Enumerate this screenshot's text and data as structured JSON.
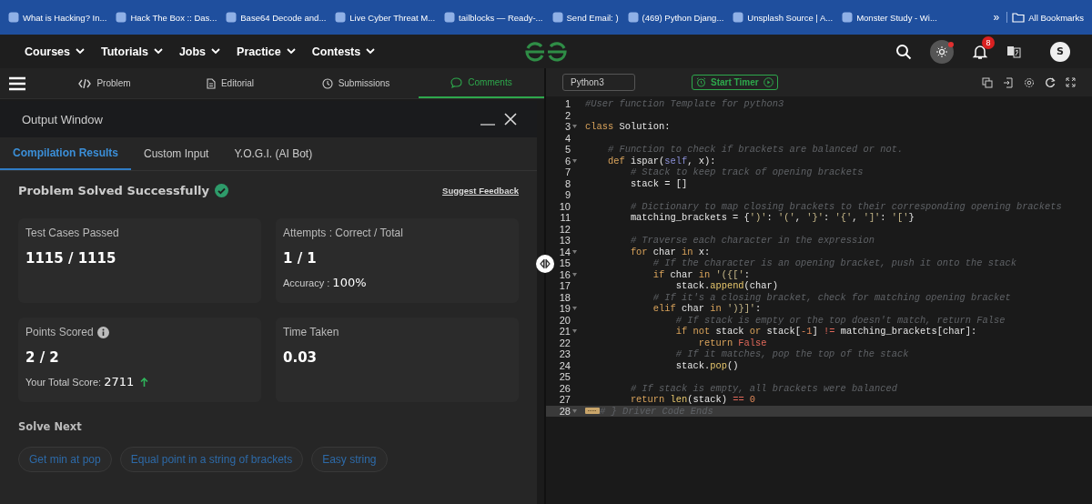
{
  "bookmarks": [
    {
      "title": "What is Hacking? In..."
    },
    {
      "title": "Hack The Box :: Das..."
    },
    {
      "title": "Base64 Decode and..."
    },
    {
      "title": "Live Cyber Threat M..."
    },
    {
      "title": "tailblocks — Ready-..."
    },
    {
      "title": "Send Email: )"
    },
    {
      "title": "(469) Python Djang..."
    },
    {
      "title": "Unsplash Source | A..."
    },
    {
      "title": "Monster Study - Wi..."
    }
  ],
  "bookmarks_more": "»",
  "all_bookmarks": "All Bookmarks",
  "nav": {
    "menus": [
      {
        "label": "Courses"
      },
      {
        "label": "Tutorials"
      },
      {
        "label": "Jobs"
      },
      {
        "label": "Practice"
      },
      {
        "label": "Contests"
      }
    ],
    "notifications": "8",
    "avatar": "S"
  },
  "problem_tabs": [
    {
      "label": "Problem",
      "selected": false
    },
    {
      "label": "Editorial",
      "selected": false
    },
    {
      "label": "Submissions",
      "selected": false
    },
    {
      "label": "Comments",
      "selected": true
    }
  ],
  "output_window": {
    "title": "Output Window",
    "tabs": [
      {
        "label": "Compilation Results",
        "selected": true
      },
      {
        "label": "Custom Input",
        "selected": false
      },
      {
        "label": "Y.O.G.I. (AI Bot)",
        "selected": false
      }
    ],
    "status": "Problem Solved Successfully",
    "feedback_link": "Suggest Feedback",
    "cards": [
      {
        "label": "Test Cases Passed",
        "info_icon": false,
        "value": "1115 / 1115"
      },
      {
        "label": "Attempts : Correct / Total",
        "info_icon": false,
        "value": "1 / 1",
        "sub": {
          "label": "Accuracy : ",
          "value": "100%",
          "rising": false
        }
      },
      {
        "label": "Points Scored",
        "info_icon": true,
        "value": "2 / 2",
        "sub": {
          "label": "Your Total Score: ",
          "value": "2711",
          "rising": true
        }
      },
      {
        "label": "Time Taken",
        "info_icon": false,
        "value": "0.03"
      }
    ],
    "solve_next": {
      "heading": "Solve Next",
      "items": [
        {
          "label": "Get min at pop"
        },
        {
          "label": "Equal point in a string of brackets"
        },
        {
          "label": "Easy string"
        }
      ]
    }
  },
  "editor": {
    "language": "Python3",
    "timer_button": "Start Timer",
    "lines": [
      {
        "n": "1",
        "fold": false,
        "active": false,
        "folded_marker": false,
        "tokens": [
          {
            "kind": "comment",
            "text": "#User function Template for python3"
          }
        ]
      },
      {
        "n": "2",
        "fold": false,
        "active": false,
        "folded_marker": false
      },
      {
        "n": "3",
        "fold": true,
        "active": false,
        "folded_marker": false,
        "tokens": [
          {
            "kind": "keyword",
            "text": "class"
          },
          {
            "kind": "plain",
            "text": " Solution:"
          }
        ]
      },
      {
        "n": "4",
        "fold": false,
        "active": false,
        "folded_marker": false
      },
      {
        "n": "5",
        "fold": false,
        "active": false,
        "folded_marker": false,
        "tokens": [
          {
            "kind": "comment",
            "text": "    # Function to check if brackets are balanced or not."
          }
        ]
      },
      {
        "n": "6",
        "fold": true,
        "active": false,
        "folded_marker": false,
        "tokens": [
          {
            "kind": "keyword",
            "text": "    def"
          },
          {
            "kind": "plain",
            "text": " ispar("
          },
          {
            "kind": "builtin",
            "text": "self"
          },
          {
            "kind": "plain",
            "text": ", x):"
          }
        ]
      },
      {
        "n": "7",
        "fold": false,
        "active": false,
        "folded_marker": false,
        "tokens": [
          {
            "kind": "comment",
            "text": "        # Stack to keep track of opening brackets"
          }
        ]
      },
      {
        "n": "8",
        "fold": false,
        "active": false,
        "folded_marker": false,
        "tokens": [
          {
            "kind": "plain",
            "text": "        stack = []"
          }
        ]
      },
      {
        "n": "9",
        "fold": false,
        "active": false,
        "folded_marker": false
      },
      {
        "n": "10",
        "fold": false,
        "active": false,
        "folded_marker": false,
        "tokens": [
          {
            "kind": "comment",
            "text": "        # Dictionary to map closing brackets to their corresponding opening brackets"
          }
        ]
      },
      {
        "n": "11",
        "fold": false,
        "active": false,
        "folded_marker": false,
        "tokens": [
          {
            "kind": "plain",
            "text": "        matching_brackets = {"
          },
          {
            "kind": "string",
            "text": "')'"
          },
          {
            "kind": "plain",
            "text": ": "
          },
          {
            "kind": "string",
            "text": "'('"
          },
          {
            "kind": "plain",
            "text": ", "
          },
          {
            "kind": "string",
            "text": "'}'"
          },
          {
            "kind": "plain",
            "text": ": "
          },
          {
            "kind": "string",
            "text": "'{'"
          },
          {
            "kind": "plain",
            "text": ", "
          },
          {
            "kind": "string",
            "text": "']'"
          },
          {
            "kind": "plain",
            "text": ": "
          },
          {
            "kind": "string",
            "text": "'['"
          },
          {
            "kind": "plain",
            "text": "}"
          }
        ]
      },
      {
        "n": "12",
        "fold": false,
        "active": false,
        "folded_marker": false
      },
      {
        "n": "13",
        "fold": false,
        "active": false,
        "folded_marker": false,
        "tokens": [
          {
            "kind": "comment",
            "text": "        # Traverse each character in the expression"
          }
        ]
      },
      {
        "n": "14",
        "fold": true,
        "active": false,
        "folded_marker": false,
        "tokens": [
          {
            "kind": "keyword",
            "text": "        for"
          },
          {
            "kind": "plain",
            "text": " char "
          },
          {
            "kind": "keyword",
            "text": "in"
          },
          {
            "kind": "plain",
            "text": " x:"
          }
        ]
      },
      {
        "n": "15",
        "fold": false,
        "active": false,
        "folded_marker": false,
        "tokens": [
          {
            "kind": "comment",
            "text": "            # If the character is an opening bracket, push it onto the stack"
          }
        ]
      },
      {
        "n": "16",
        "fold": true,
        "active": false,
        "folded_marker": false,
        "tokens": [
          {
            "kind": "keyword",
            "text": "            if"
          },
          {
            "kind": "plain",
            "text": " char "
          },
          {
            "kind": "keyword",
            "text": "in"
          },
          {
            "kind": "string",
            "text": " '({['"
          },
          {
            "kind": "plain",
            "text": ":"
          }
        ]
      },
      {
        "n": "17",
        "fold": false,
        "active": false,
        "folded_marker": false,
        "tokens": [
          {
            "kind": "plain",
            "text": "                stack."
          },
          {
            "kind": "call",
            "text": "append"
          },
          {
            "kind": "plain",
            "text": "(char)"
          }
        ]
      },
      {
        "n": "18",
        "fold": false,
        "active": false,
        "folded_marker": false,
        "tokens": [
          {
            "kind": "comment",
            "text": "            # If it's a closing bracket, check for matching opening bracket"
          }
        ]
      },
      {
        "n": "19",
        "fold": true,
        "active": false,
        "folded_marker": false,
        "tokens": [
          {
            "kind": "keyword",
            "text": "            elif"
          },
          {
            "kind": "plain",
            "text": " char "
          },
          {
            "kind": "keyword",
            "text": "in"
          },
          {
            "kind": "string",
            "text": " ')}]'"
          },
          {
            "kind": "plain",
            "text": ":"
          }
        ]
      },
      {
        "n": "20",
        "fold": false,
        "active": false,
        "folded_marker": false,
        "tokens": [
          {
            "kind": "comment",
            "text": "                # If stack is empty or the top doesn't match, return False"
          }
        ]
      },
      {
        "n": "21",
        "fold": true,
        "active": false,
        "folded_marker": false,
        "tokens": [
          {
            "kind": "keyword",
            "text": "                if not"
          },
          {
            "kind": "plain",
            "text": " stack "
          },
          {
            "kind": "keyword",
            "text": "or"
          },
          {
            "kind": "plain",
            "text": " stack["
          },
          {
            "kind": "number",
            "text": "-1"
          },
          {
            "kind": "plain",
            "text": "] "
          },
          {
            "kind": "operator",
            "text": "!="
          },
          {
            "kind": "plain",
            "text": " matching_brackets[char]:"
          }
        ]
      },
      {
        "n": "22",
        "fold": false,
        "active": false,
        "folded_marker": false,
        "tokens": [
          {
            "kind": "keyword",
            "text": "                    return"
          },
          {
            "kind": "constant",
            "text": " False"
          }
        ]
      },
      {
        "n": "23",
        "fold": false,
        "active": false,
        "folded_marker": false,
        "tokens": [
          {
            "kind": "comment",
            "text": "                # If it matches, pop the top of the stack"
          }
        ]
      },
      {
        "n": "24",
        "fold": false,
        "active": false,
        "folded_marker": false,
        "tokens": [
          {
            "kind": "plain",
            "text": "                stack."
          },
          {
            "kind": "call",
            "text": "pop"
          },
          {
            "kind": "plain",
            "text": "()"
          }
        ]
      },
      {
        "n": "25",
        "fold": false,
        "active": false,
        "folded_marker": false
      },
      {
        "n": "26",
        "fold": false,
        "active": false,
        "folded_marker": false,
        "tokens": [
          {
            "kind": "comment",
            "text": "        # If stack is empty, all brackets were balanced"
          }
        ]
      },
      {
        "n": "27",
        "fold": false,
        "active": false,
        "folded_marker": false,
        "tokens": [
          {
            "kind": "keyword",
            "text": "        return"
          },
          {
            "kind": "call",
            "text": " len"
          },
          {
            "kind": "plain",
            "text": "(stack) "
          },
          {
            "kind": "operator",
            "text": "=="
          },
          {
            "kind": "number",
            "text": " 0"
          }
        ]
      },
      {
        "n": "28",
        "fold": true,
        "active": true,
        "folded_marker": true,
        "tokens": [
          {
            "kind": "comment",
            "text": "# } Driver Code Ends"
          }
        ]
      }
    ]
  }
}
